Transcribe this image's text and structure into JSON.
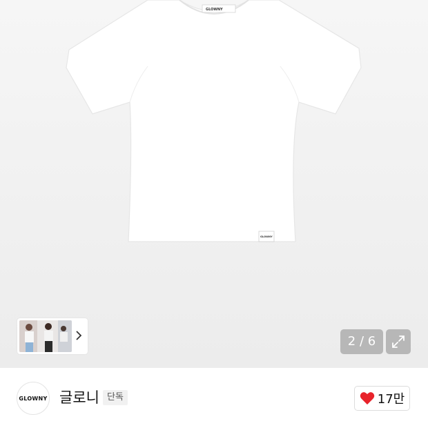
{
  "hero": {
    "image_description_icon": "tshirt-product-image",
    "gallery_counter": "2 / 6",
    "expand_icon": "expand-icon",
    "thumbnail_chevron_icon": "chevron-right-icon",
    "product_label_text": "GLOWNY"
  },
  "brand": {
    "logo_text": "GLOWNY",
    "name": "글로니",
    "badge": "단독",
    "like_icon": "heart-icon",
    "like_color": "#e8232b",
    "like_count": "17만"
  }
}
